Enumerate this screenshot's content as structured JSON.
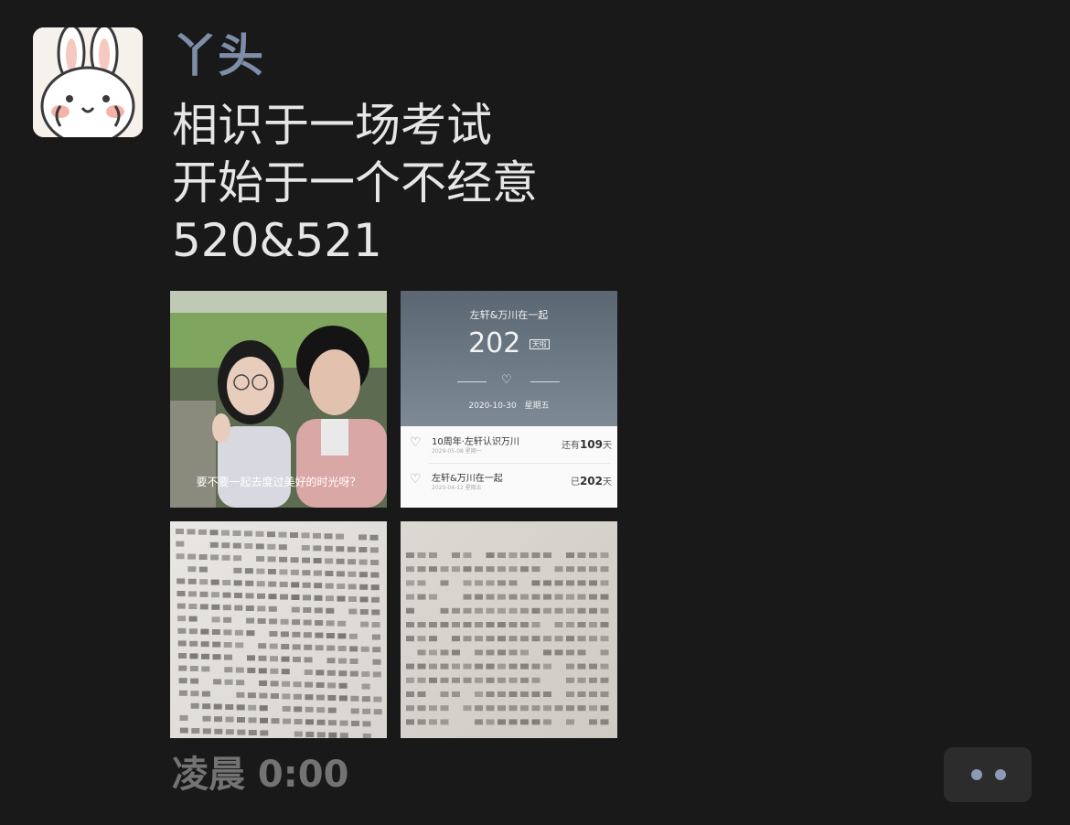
{
  "post": {
    "username": "丫头",
    "text_lines": [
      "相识于一场考试",
      "开始于一个不经意",
      "520&521"
    ],
    "timestamp": "凌晨 0:00"
  },
  "photos": {
    "photo1": {
      "caption": "要不要一起去度过美好的时光呀？"
    },
    "photo2": {
      "header_title": "左轩&万川在一起",
      "day_count": "202",
      "day_unit": "天啦",
      "date": "2020-10-30",
      "weekday": "星期五",
      "rows": [
        {
          "title": "10周年·左轩认识万川",
          "subtitle": "2029-05-08 星期一",
          "right_prefix": "还有",
          "right_value": "109",
          "right_suffix": "天"
        },
        {
          "title": "左轩&万川在一起",
          "subtitle": "2020-04-12 星期五",
          "right_prefix": "已",
          "right_value": "202",
          "right_suffix": "天"
        }
      ]
    }
  },
  "colors": {
    "background": "#191919",
    "username": "#7e8ea8",
    "text": "#e6e6e6",
    "timestamp": "#737373",
    "more_button": "#2c2c2c",
    "more_dots": "#8c9ab3"
  },
  "icons": [
    "bunny-avatar-icon",
    "heart-icon",
    "more-dots-icon"
  ]
}
